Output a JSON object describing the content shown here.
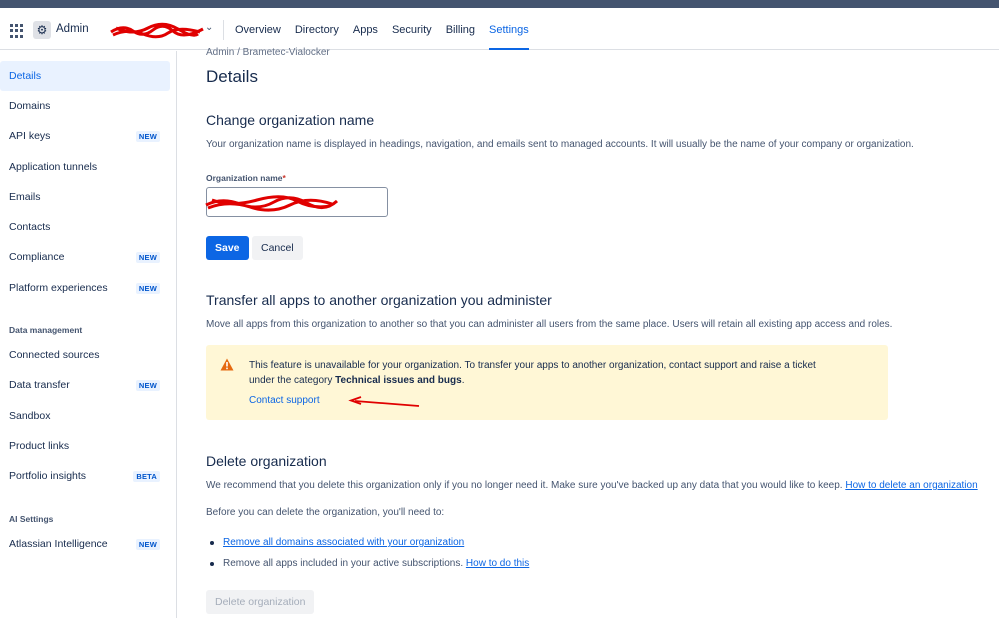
{
  "nav": {
    "admin_label": "Admin",
    "org_name": "████████",
    "items": [
      {
        "label": "Overview",
        "active": false
      },
      {
        "label": "Directory",
        "active": false
      },
      {
        "label": "Apps",
        "active": false
      },
      {
        "label": "Security",
        "active": false
      },
      {
        "label": "Billing",
        "active": false
      },
      {
        "label": "Settings",
        "active": true
      }
    ]
  },
  "sidebar": {
    "items": [
      {
        "label": "Details",
        "badge": "",
        "active": true
      },
      {
        "label": "Domains",
        "badge": ""
      },
      {
        "label": "API keys",
        "badge": "NEW"
      },
      {
        "label": "Application tunnels",
        "badge": ""
      },
      {
        "label": "Emails",
        "badge": ""
      },
      {
        "label": "Contacts",
        "badge": ""
      },
      {
        "label": "Compliance",
        "badge": "NEW"
      },
      {
        "label": "Platform experiences",
        "badge": "NEW"
      }
    ],
    "data_management_heading": "Data management",
    "data_management_items": [
      {
        "label": "Connected sources",
        "badge": ""
      },
      {
        "label": "Data transfer",
        "badge": "NEW"
      },
      {
        "label": "Sandbox",
        "badge": ""
      },
      {
        "label": "Product links",
        "badge": ""
      },
      {
        "label": "Portfolio insights",
        "badge": "BETA"
      }
    ],
    "ai_heading": "AI Settings",
    "ai_items": [
      {
        "label": "Atlassian Intelligence",
        "badge": "NEW"
      }
    ]
  },
  "main": {
    "breadcrumb": "Admin  /  Brametec-Vialocker",
    "page_title": "Details",
    "change_name": {
      "title": "Change organization name",
      "desc": "Your organization name is displayed in headings, navigation, and emails sent to managed accounts. It will usually be the name of your company or organization.",
      "field_label": "Organization name",
      "required_mark": "*",
      "field_value": "",
      "save_label": "Save",
      "cancel_label": "Cancel"
    },
    "transfer": {
      "title": "Transfer all apps to another organization you administer",
      "desc": "Move all apps from this organization to another so that you can administer all users from the same place. Users will retain all existing app access and roles.",
      "warning_text_1": "This feature is unavailable for your organization. To transfer your apps to another organization, contact support and raise a ticket",
      "warning_text_2a": "under the category ",
      "warning_text_2b": "Technical issues and bugs",
      "warning_text_2c": ".",
      "contact_link": "Contact support"
    },
    "delete": {
      "title": "Delete organization",
      "desc": "We recommend that you delete this organization only if you no longer need it. Make sure you've backed up any data that you would like to keep. ",
      "desc_link": "How to delete an organization",
      "before_text": "Before you can delete the organization, you'll need to:",
      "bullet_1_link": "Remove all domains associated with your organization",
      "bullet_2_text": "Remove all apps included in your active subscriptions. ",
      "bullet_2_link": "How to do this",
      "delete_button": "Delete organization"
    }
  },
  "colors": {
    "accent": "#0c66e4",
    "warning_bg": "#fff7d6",
    "warning_icon": "#e56910",
    "annotation_red": "#e00000"
  }
}
